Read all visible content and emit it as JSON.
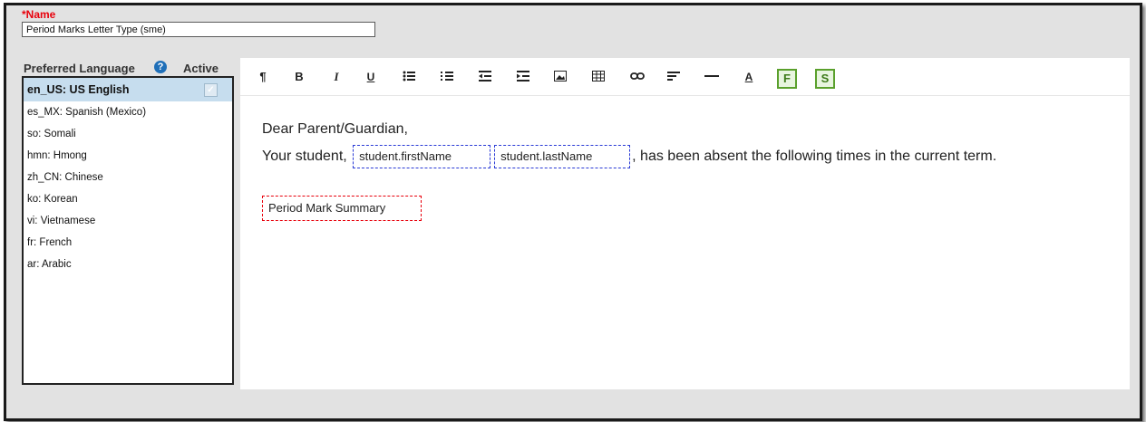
{
  "name_field": {
    "label": "*Name",
    "value": "Period Marks Letter Type (sme)"
  },
  "languages": {
    "header": "Preferred Language",
    "active_header": "Active",
    "items": [
      {
        "label": "en_US: US English",
        "selected": true,
        "active": true
      },
      {
        "label": "es_MX: Spanish (Mexico)"
      },
      {
        "label": "so: Somali"
      },
      {
        "label": "hmn: Hmong"
      },
      {
        "label": "zh_CN: Chinese"
      },
      {
        "label": "ko: Korean"
      },
      {
        "label": "vi: Vietnamese"
      },
      {
        "label": "fr: French"
      },
      {
        "label": "ar: Arabic"
      }
    ]
  },
  "toolbar": {
    "items": [
      {
        "name": "paragraph-icon",
        "glyph": "¶"
      },
      {
        "name": "bold-icon",
        "glyph": "B"
      },
      {
        "name": "italic-icon",
        "glyph": "I"
      },
      {
        "name": "underline-icon",
        "glyph": "U"
      },
      {
        "name": "bullet-list-icon"
      },
      {
        "name": "numbered-list-icon"
      },
      {
        "name": "outdent-icon"
      },
      {
        "name": "indent-icon"
      },
      {
        "name": "image-icon"
      },
      {
        "name": "table-icon"
      },
      {
        "name": "link-icon"
      },
      {
        "name": "align-icon"
      },
      {
        "name": "horizontal-rule-icon"
      },
      {
        "name": "font-color-icon",
        "glyph": "A"
      },
      {
        "name": "insert-field-button",
        "glyph": "F"
      },
      {
        "name": "insert-subreport-button",
        "glyph": "S"
      }
    ],
    "accent_color": "#5aa02c"
  },
  "letter": {
    "greeting": "Dear Parent/Guardian,",
    "intro": "Your student,",
    "field_first": "student.firstName",
    "field_last": "student.lastName",
    "suffix": ", has been absent the following times in the current term.",
    "summary": "Period Mark Summary"
  }
}
